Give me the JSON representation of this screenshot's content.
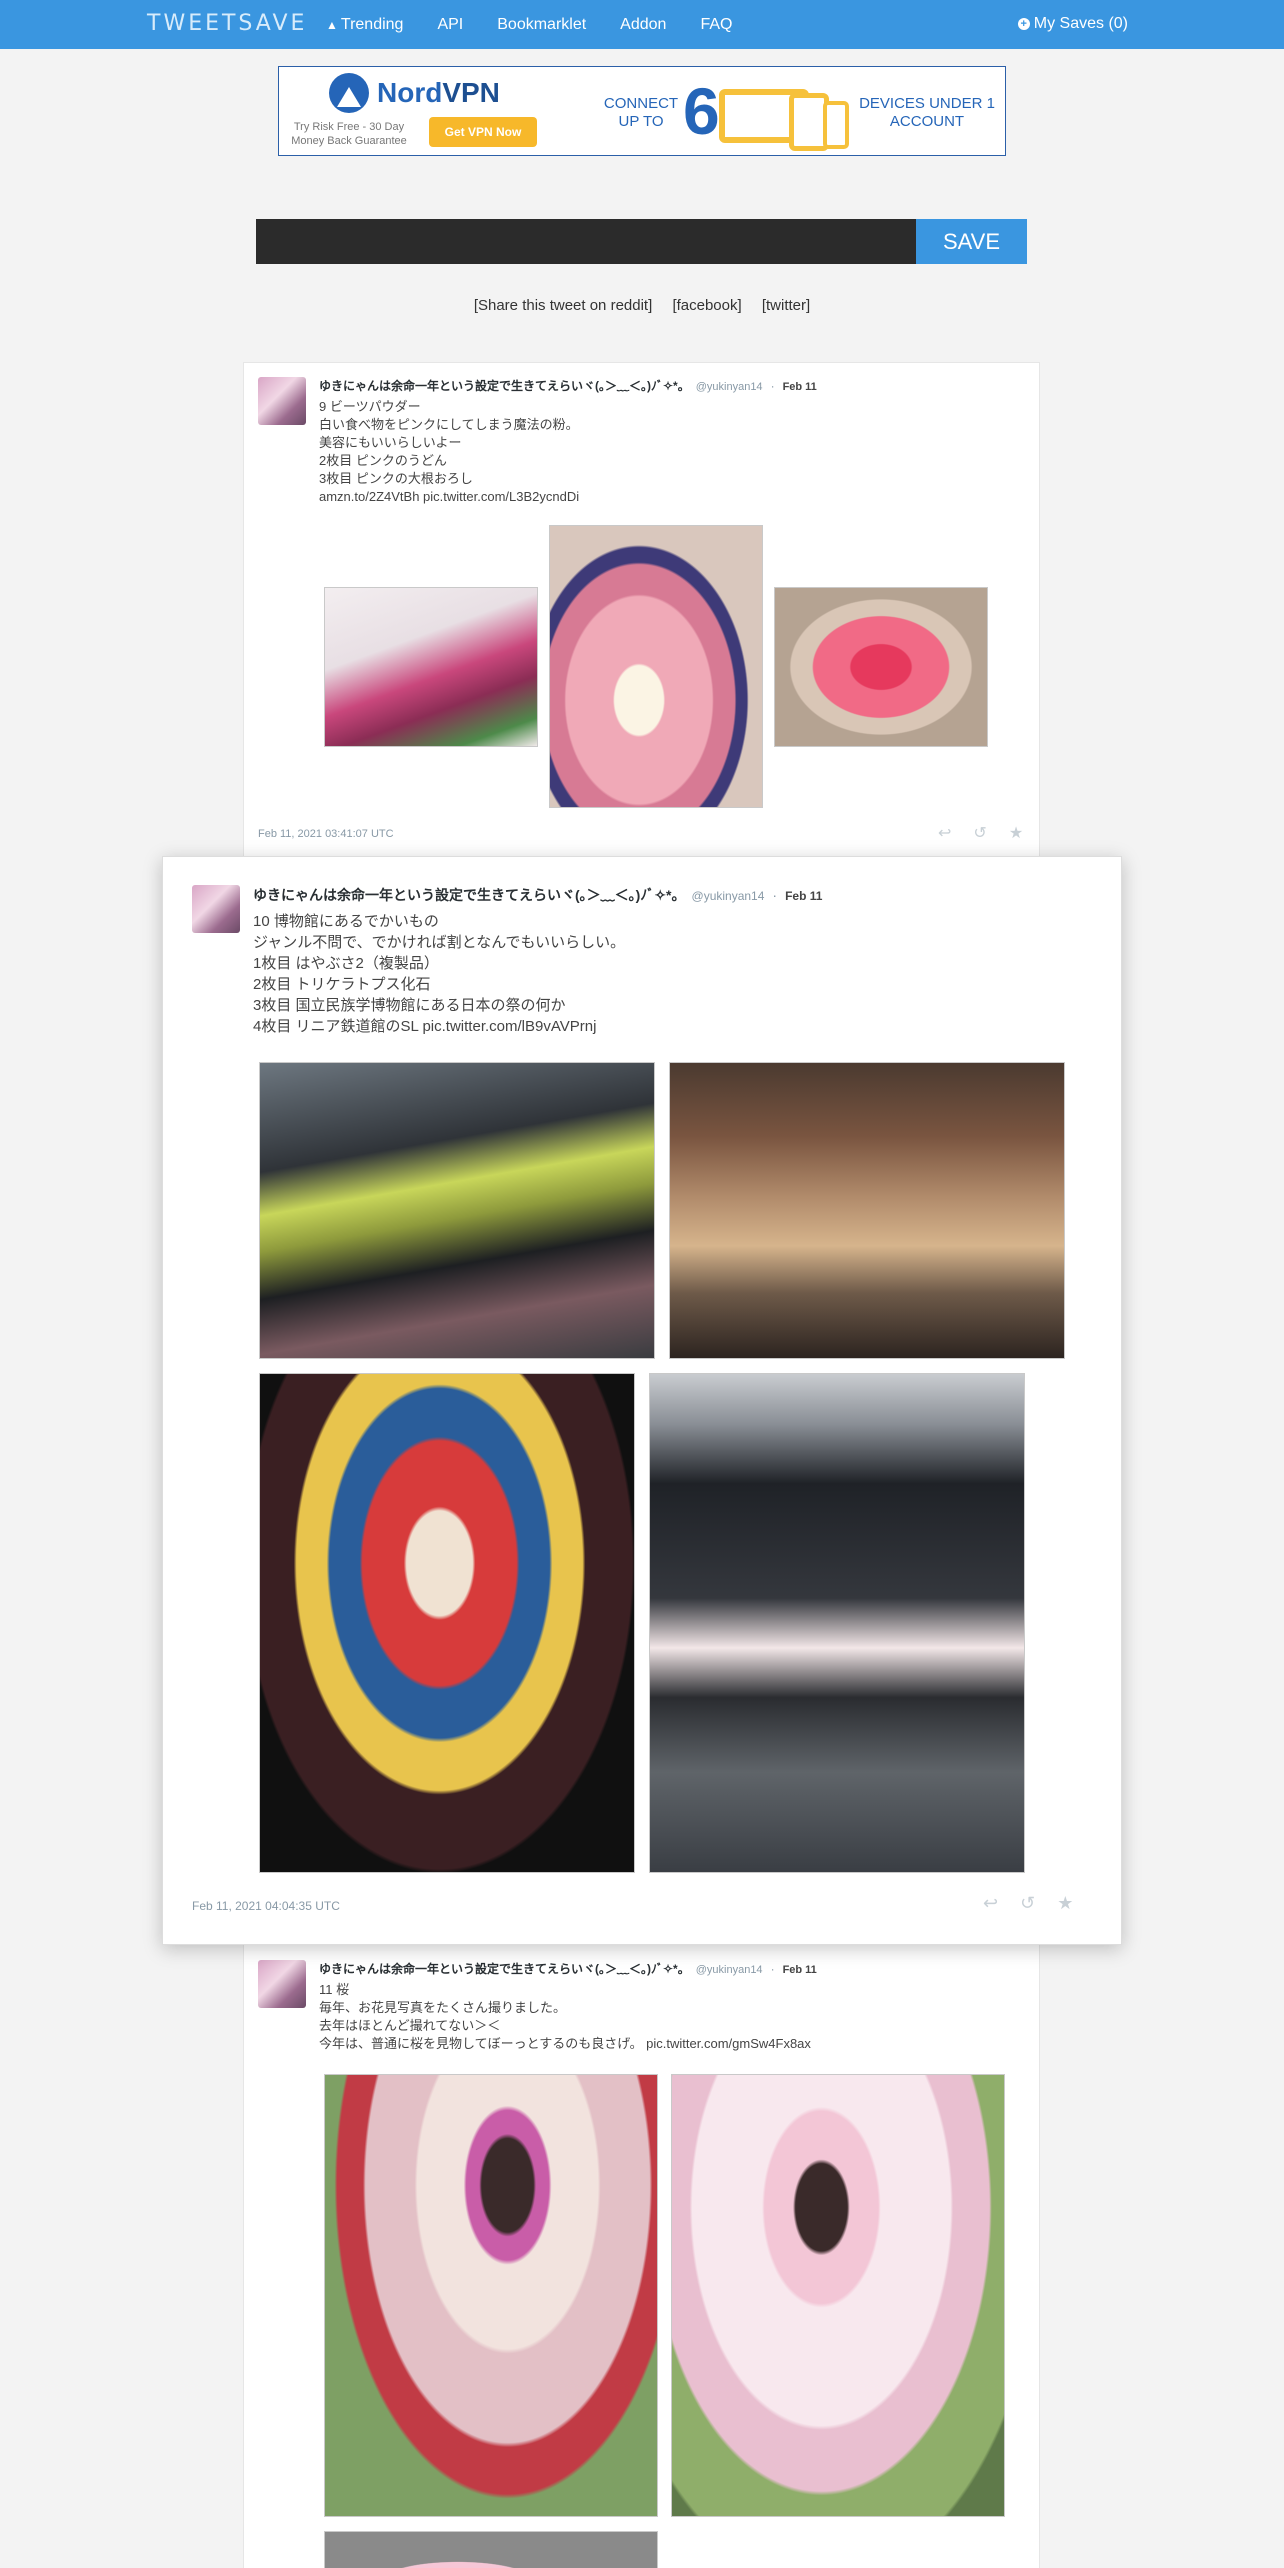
{
  "nav": {
    "brand": "TWEETSAVE",
    "links": [
      {
        "label": "Trending",
        "icon": "trending-icon"
      },
      {
        "label": "API"
      },
      {
        "label": "Bookmarklet"
      },
      {
        "label": "Addon"
      },
      {
        "label": "FAQ"
      }
    ],
    "my_saves": "My Saves (0)",
    "accent_color": "#3a96e0"
  },
  "ad": {
    "logo_brand": "Nord",
    "logo_vpn": "VPN",
    "trial_text": "Try Risk Free - 30 Day Money Back Guarantee",
    "button_label": "Get VPN Now",
    "connect_text": "CONNECT UP TO",
    "count": "6",
    "devices_text": "DEVICES UNDER 1 ACCOUNT"
  },
  "save": {
    "input_value": "",
    "button_label": "SAVE"
  },
  "share": {
    "reddit": "[Share this tweet on reddit]",
    "facebook": "[facebook]",
    "twitter": "[twitter]"
  },
  "tweets": [
    {
      "name": "ゆきにゃんは余命一年という設定で生きてえらいヾ(｡＞﹏＜｡)ﾉﾞ✧*。",
      "handle": "@yukinyan14",
      "date": "Feb 11",
      "text": "9 ビーツパウダー\n白い食べ物をピンクにしてしまう魔法の粉。\n美容にもいいらしいよー\n2枚目 ピンクのうどん\n3枚目 ピンクの大根おろし\namzn.to/2Z4VtBh pic.twitter.com/L3B2ycndDi",
      "timestamp": "Feb 11, 2021 03:41:07 UTC",
      "photos": [
        "beet-powder-package-photo",
        "pink-udon-photo",
        "pink-daikon-photo"
      ]
    },
    {
      "name": "ゆきにゃんは余命一年という設定で生きてえらいヾ(｡＞﹏＜｡)ﾉﾞ✧*。",
      "handle": "@yukinyan14",
      "date": "Feb 11",
      "text": "10 博物館にあるでかいもの\nジャンル不問で、でかければ割となんでもいいらしい。\n1枚目 はやぶさ2（複製品）\n2枚目 トリケラトプス化石\n3枚目 国立民族学博物館にある日本の祭の何か\n4枚目 リニア鉄道館のSL pic.twitter.com/lB9vAVPrnj",
      "timestamp": "Feb 11, 2021 04:04:35 UTC",
      "photos": [
        "hayabusa2-replica-photo",
        "triceratops-fossil-photo",
        "festival-float-photo",
        "steam-locomotive-photo"
      ]
    },
    {
      "name": "ゆきにゃんは余命一年という設定で生きてえらいヾ(｡＞﹏＜｡)ﾉﾞ✧*。",
      "handle": "@yukinyan14",
      "date": "Feb 11",
      "text": "11 桜\n毎年、お花見写真をたくさん撮りました。\n去年はほとんど撮れてない＞＜\n今年は、普通に桜を見物してぼーっとするのも良さげ。 pic.twitter.com/gmSw4Fx8ax",
      "timestamp": "",
      "photos": [
        "cherry-blossom-kimono-photo",
        "cherry-blossom-lolita-photo",
        "cherry-blossom-third-photo"
      ]
    }
  ]
}
